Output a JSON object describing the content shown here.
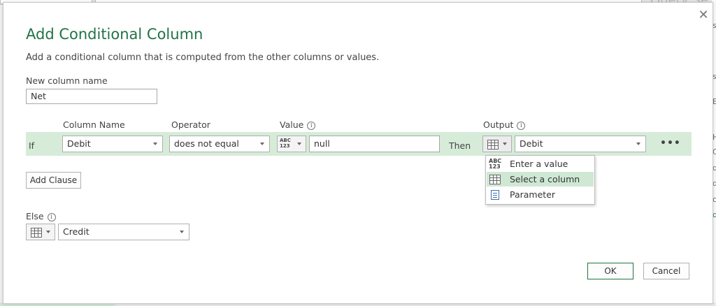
{
  "background": {
    "query_text": "Query Se",
    "right_edge_chars": [
      "s",
      "s",
      "E",
      "H",
      "C",
      "d",
      "d",
      "c",
      "d"
    ]
  },
  "dialog": {
    "title": "Add Conditional Column",
    "description": "Add a conditional column that is computed from the other columns or values.",
    "close_glyph": "✕",
    "new_column_label": "New column name",
    "new_column_value": "Net",
    "headers": {
      "column_name": "Column Name",
      "operator": "Operator",
      "value": "Value",
      "output": "Output",
      "info_glyph": "i"
    },
    "clause": {
      "if_label": "If",
      "column_name": "Debit",
      "operator": "does not equal",
      "value_type_top": "ABC",
      "value_type_bottom": "123",
      "value": "null",
      "then_label": "Then",
      "output_type_icon": "table-icon",
      "output": "Debit",
      "more_glyph": "•••"
    },
    "add_clause_label": "Add Clause",
    "else_label": "Else",
    "else_value": "Credit",
    "ok_label": "OK",
    "cancel_label": "Cancel"
  },
  "type_menu": {
    "items": [
      {
        "label": "Enter a value",
        "icon": "abc-123-icon",
        "icon_top": "ABC",
        "icon_bottom": "123",
        "selected": false
      },
      {
        "label": "Select a column",
        "icon": "table-icon",
        "selected": true
      },
      {
        "label": "Parameter",
        "icon": "parameter-icon",
        "selected": false
      }
    ]
  },
  "colors": {
    "accent": "#217346",
    "row_highlight": "#d6ecd9",
    "menu_selected": "#cfe8d4"
  }
}
